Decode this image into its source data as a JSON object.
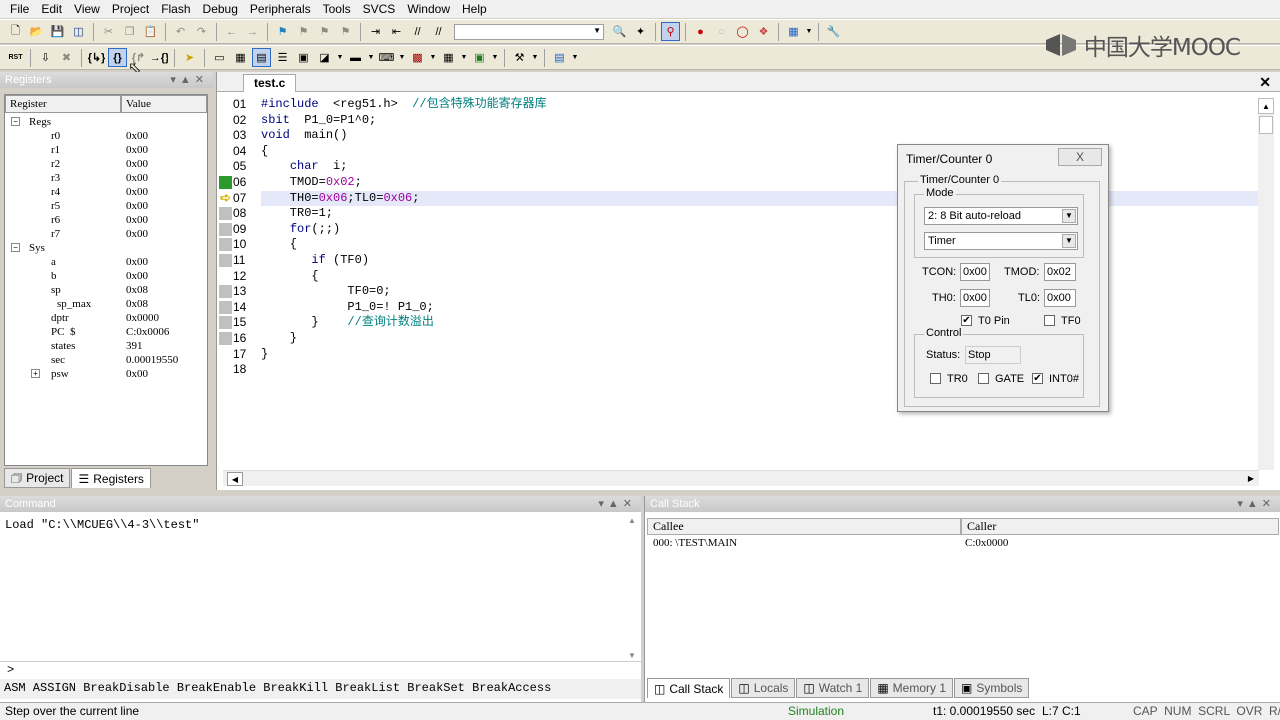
{
  "menu": [
    "File",
    "Edit",
    "View",
    "Project",
    "Flash",
    "Debug",
    "Peripherals",
    "Tools",
    "SVCS",
    "Window",
    "Help"
  ],
  "logo": {
    "text": "中国大学MOOC"
  },
  "registers": {
    "title": "Registers",
    "col_register": "Register",
    "col_value": "Value",
    "groups": [
      {
        "label": "Regs",
        "items": [
          {
            "name": "r0",
            "value": "0x00"
          },
          {
            "name": "r1",
            "value": "0x00"
          },
          {
            "name": "r2",
            "value": "0x00"
          },
          {
            "name": "r3",
            "value": "0x00"
          },
          {
            "name": "r4",
            "value": "0x00"
          },
          {
            "name": "r5",
            "value": "0x00"
          },
          {
            "name": "r6",
            "value": "0x00"
          },
          {
            "name": "r7",
            "value": "0x00"
          }
        ]
      },
      {
        "label": "Sys",
        "items": [
          {
            "name": "a",
            "value": "0x00"
          },
          {
            "name": "b",
            "value": "0x00"
          },
          {
            "name": "sp",
            "value": "0x08"
          },
          {
            "name": "sp_max",
            "value": "0x08"
          },
          {
            "name": "dptr",
            "value": "0x0000"
          },
          {
            "name": "PC  $",
            "value": "C:0x0006"
          },
          {
            "name": "states",
            "value": "391"
          },
          {
            "name": "sec",
            "value": "0.00019550"
          },
          {
            "name": "psw",
            "value": "0x00"
          }
        ]
      }
    ],
    "tabs": [
      "Project",
      "Registers"
    ]
  },
  "editor": {
    "tab": "test.c",
    "lines": [
      {
        "n": "01",
        "code": "#include  <reg51.h>  ",
        "comment": "//包含特殊功能寄存器库"
      },
      {
        "n": "02",
        "code": "sbit  P1_0=P1^0;",
        "comment": ""
      },
      {
        "n": "03",
        "code": "void  main()",
        "comment": ""
      },
      {
        "n": "04",
        "code": "{",
        "comment": ""
      },
      {
        "n": "05",
        "code": "    char  i;",
        "comment": ""
      },
      {
        "n": "06",
        "code": "    TMOD=0x02;",
        "comment": ""
      },
      {
        "n": "07",
        "code": "    TH0=0x06;TL0=0x06;",
        "comment": ""
      },
      {
        "n": "08",
        "code": "    TR0=1;",
        "comment": ""
      },
      {
        "n": "09",
        "code": "    for(;;)",
        "comment": ""
      },
      {
        "n": "10",
        "code": "    {",
        "comment": ""
      },
      {
        "n": "11",
        "code": "       if (TF0)",
        "comment": ""
      },
      {
        "n": "12",
        "code": "       {",
        "comment": ""
      },
      {
        "n": "13",
        "code": "            TF0=0;",
        "comment": ""
      },
      {
        "n": "14",
        "code": "            P1_0=! P1_0;",
        "comment": ""
      },
      {
        "n": "15",
        "code": "       }    ",
        "comment": "//查询计数溢出"
      },
      {
        "n": "16",
        "code": "    }",
        "comment": ""
      },
      {
        "n": "17",
        "code": "}",
        "comment": ""
      },
      {
        "n": "18",
        "code": "",
        "comment": ""
      }
    ]
  },
  "timer_dialog": {
    "title": "Timer/Counter 0",
    "close": "X",
    "group_title": "Timer/Counter 0",
    "mode_label": "Mode",
    "mode_value": "2: 8 Bit auto-reload",
    "type_value": "Timer",
    "tcon_label": "TCON:",
    "tcon_value": "0x00",
    "tmod_label": "TMOD:",
    "tmod_value": "0x02",
    "th0_label": "TH0:",
    "th0_value": "0x00",
    "tl0_label": "TL0:",
    "tl0_value": "0x00",
    "t0pin_label": "T0 Pin",
    "t0pin_checked": true,
    "tf0_label": "TF0",
    "tf0_checked": false,
    "control_label": "Control",
    "status_label": "Status:",
    "status_value": "Stop",
    "tr0_label": "TR0",
    "tr0_checked": false,
    "gate_label": "GATE",
    "gate_checked": false,
    "int0_label": "INT0#",
    "int0_checked": true
  },
  "command": {
    "title": "Command",
    "output": "Load \"C:\\\\MCUEG\\\\4-3\\\\test\"",
    "prompt": ">",
    "help": "ASM ASSIGN BreakDisable BreakEnable BreakKill BreakList BreakSet BreakAccess"
  },
  "callstack": {
    "title": "Call Stack",
    "col_callee": "Callee",
    "col_caller": "Caller",
    "row_callee": "000:  \\TEST\\MAIN",
    "row_caller": "C:0x0000",
    "tabs": [
      "Call Stack",
      "Locals",
      "Watch 1",
      "Memory 1",
      "Symbols"
    ]
  },
  "status": {
    "hint": "Step over the current line",
    "mode": "Simulation",
    "time": "t1: 0.00019550 sec",
    "pos": "L:7 C:1",
    "keys": "CAP  NUM  SCRL  OVR  R/W"
  }
}
